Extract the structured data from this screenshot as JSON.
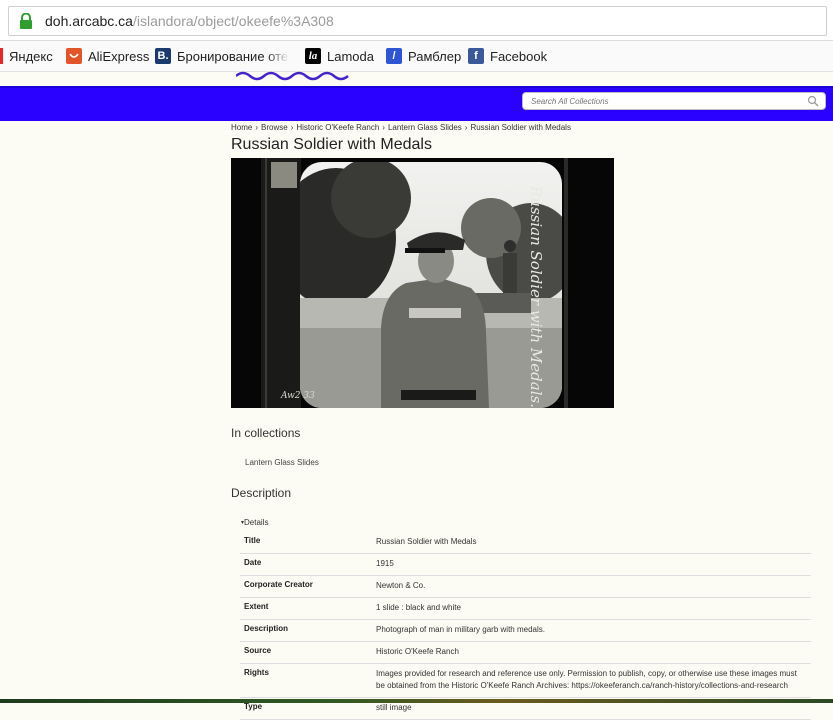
{
  "browser": {
    "url_host": "doh.arcabc.ca",
    "url_path": "/islandora/object/okeefe%3A308",
    "bookmarks": [
      {
        "label": "Яндекс",
        "icon": "yandex-icon",
        "color": "#e8262a"
      },
      {
        "label": "AliExpress",
        "icon": "aliexpress-icon",
        "color": "#e2542a"
      },
      {
        "label": "Бронирование отеле",
        "icon": "booking-icon",
        "color": "#1a3a6e"
      },
      {
        "label": "Lamoda",
        "icon": "lamoda-icon",
        "color": "#000000"
      },
      {
        "label": "Рамблер",
        "icon": "rambler-icon",
        "color": "#2f55d4"
      },
      {
        "label": "Facebook",
        "icon": "facebook-icon",
        "color": "#3b5998"
      }
    ]
  },
  "header": {
    "brand_color": "#2a00ff",
    "search_placeholder": "Search All Collections"
  },
  "breadcrumb": [
    "Home",
    "Browse",
    "Historic O'Keefe Ranch",
    "Lantern Glass Slides",
    "Russian Soldier with Medals"
  ],
  "page_title": "Russian Soldier with Medals",
  "photo": {
    "handwritten_caption": "Russian Soldier with Medals.",
    "corner_mark": "Aw2 33"
  },
  "collections": {
    "heading": "In collections",
    "items": [
      "Lantern Glass Slides"
    ]
  },
  "description": {
    "heading": "Description",
    "details_toggle": "Details",
    "rows": [
      {
        "key": "Title",
        "value": "Russian Soldier with Medals"
      },
      {
        "key": "Date",
        "value": "1915"
      },
      {
        "key": "Corporate Creator",
        "value": "Newton & Co."
      },
      {
        "key": "Extent",
        "value": "1 slide : black and white"
      },
      {
        "key": "Description",
        "value": "Photograph of man in military garb with medals."
      },
      {
        "key": "Source",
        "value": "Historic O'Keefe Ranch"
      },
      {
        "key": "Rights",
        "value": "Images provided for research and reference use only. Permission to publish, copy, or otherwise use these images must be obtained from the Historic O'Keefe Ranch Archives: https://okeeferanch.ca/ranch-history/collections-and-research"
      },
      {
        "key": "Type",
        "value": "still image"
      }
    ]
  }
}
